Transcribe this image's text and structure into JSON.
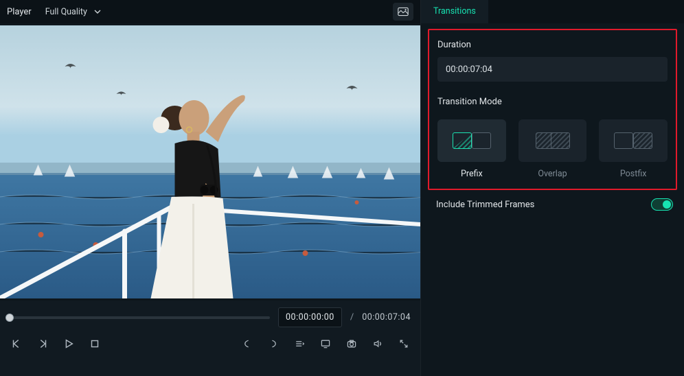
{
  "player": {
    "title": "Player",
    "quality": "Full Quality",
    "current_time": "00:00:00:00",
    "separator": "/",
    "total_time": "00:00:07:04"
  },
  "side": {
    "tab": "Transitions",
    "duration_label": "Duration",
    "duration_value": "00:00:07:04",
    "mode_label": "Transition Mode",
    "modes": {
      "prefix": "Prefix",
      "overlap": "Overlap",
      "postfix": "Postfix"
    },
    "trimmed_label": "Include Trimmed Frames"
  }
}
